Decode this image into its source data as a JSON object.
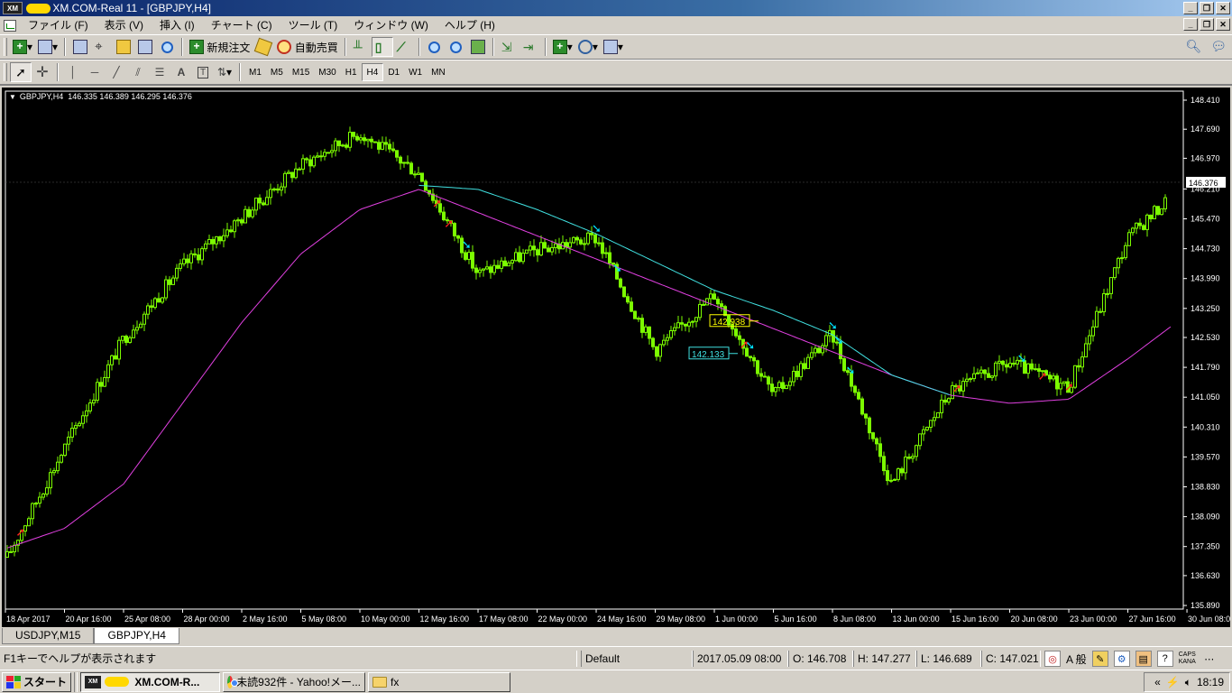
{
  "window": {
    "title": "XM.COM-Real 11 - [GBPJPY,H4]",
    "app_logo": "XM"
  },
  "menu": [
    "ファイル (F)",
    "表示 (V)",
    "挿入 (I)",
    "チャート (C)",
    "ツール (T)",
    "ウィンドウ (W)",
    "ヘルプ (H)"
  ],
  "toolbar1": {
    "new_order_label": "新規注文",
    "auto_trade_label": "自動売買"
  },
  "timeframes": [
    "M1",
    "M5",
    "M15",
    "M30",
    "H1",
    "H4",
    "D1",
    "W1",
    "MN"
  ],
  "active_timeframe": "H4",
  "chart": {
    "symbol_label": "GBPJPY,H4",
    "ohlc_label": "146.335 146.389 146.295 146.376",
    "current_price": "146.376",
    "annotation_upper": "142.938",
    "annotation_lower": "142.133",
    "background": "#000000",
    "candle_color": "#7cfc00",
    "ma_fast_color": "#40e0e0",
    "ma_slow_color": "#e040e0",
    "signal_up_color": "#ff2020",
    "signal_down_color": "#00e0ff"
  },
  "chart_data": {
    "type": "line",
    "title": "GBPJPY,H4",
    "x_tick_labels": [
      "18 Apr 2017",
      "20 Apr 16:00",
      "25 Apr 08:00",
      "28 Apr 00:00",
      "2 May 16:00",
      "5 May 08:00",
      "10 May 00:00",
      "12 May 16:00",
      "17 May 08:00",
      "22 May 00:00",
      "24 May 16:00",
      "29 May 08:00",
      "1 Jun 00:00",
      "5 Jun 16:00",
      "8 Jun 08:00",
      "13 Jun 00:00",
      "15 Jun 16:00",
      "20 Jun 08:00",
      "23 Jun 00:00",
      "27 Jun 16:00",
      "30 Jun 08:00"
    ],
    "y_tick_labels": [
      "148.410",
      "147.690",
      "146.970",
      "146.210",
      "145.470",
      "144.730",
      "143.990",
      "143.250",
      "142.530",
      "141.790",
      "141.050",
      "140.310",
      "139.570",
      "138.830",
      "138.090",
      "137.350",
      "136.630",
      "135.890"
    ],
    "ylim": [
      135.89,
      148.41
    ],
    "series": [
      {
        "name": "GBPJPY,H4",
        "x": [
          "18 Apr 2017",
          "20 Apr 16:00",
          "25 Apr 08:00",
          "28 Apr 00:00",
          "2 May 16:00",
          "5 May 08:00",
          "10 May 00:00",
          "12 May 16:00",
          "17 May 08:00",
          "22 May 00:00",
          "24 May 16:00",
          "29 May 08:00",
          "1 Jun 00:00",
          "5 Jun 16:00",
          "8 Jun 08:00",
          "13 Jun 00:00",
          "15 Jun 16:00",
          "20 Jun 08:00",
          "23 Jun 00:00",
          "27 Jun 16:00",
          "30 Jun 08:00"
        ],
        "values": [
          137.0,
          139.8,
          142.5,
          144.3,
          145.5,
          146.8,
          147.6,
          146.6,
          144.1,
          144.7,
          145.0,
          142.2,
          143.6,
          141.1,
          142.6,
          138.9,
          141.2,
          141.9,
          141.3,
          145.0,
          146.4
        ]
      },
      {
        "name": "MA slow",
        "x": [
          "18 Apr 2017",
          "20 Apr 16:00",
          "25 Apr 08:00",
          "28 Apr 00:00",
          "2 May 16:00",
          "5 May 08:00",
          "10 May 00:00",
          "12 May 16:00",
          "13 Jun 00:00",
          "15 Jun 16:00",
          "20 Jun 08:00",
          "23 Jun 00:00",
          "27 Jun 16:00",
          "30 Jun 08:00"
        ],
        "values": [
          137.3,
          137.8,
          138.9,
          140.9,
          142.9,
          144.6,
          145.7,
          146.2,
          141.6,
          141.1,
          140.9,
          141.0,
          142.0,
          143.1
        ]
      },
      {
        "name": "MA fast",
        "x": [
          "12 May 16:00",
          "17 May 08:00",
          "22 May 00:00",
          "24 May 16:00",
          "29 May 08:00",
          "1 Jun 00:00",
          "5 Jun 16:00",
          "8 Jun 08:00",
          "13 Jun 00:00",
          "15 Jun 16:00"
        ],
        "values": [
          146.3,
          146.2,
          145.7,
          145.1,
          144.4,
          143.7,
          143.2,
          142.6,
          141.6,
          141.1
        ]
      }
    ]
  },
  "chart_tabs": [
    "USDJPY,M15",
    "GBPJPY,H4"
  ],
  "active_chart_tab": "GBPJPY,H4",
  "status": {
    "help": "F1キーでヘルプが表示されます",
    "profile": "Default",
    "datetime": "2017.05.09 08:00",
    "open": "O: 146.708",
    "high": "H: 147.277",
    "low": "L: 146.689",
    "close": "C: 147.021",
    "ime_mode": "A 般",
    "caps": "CAPS",
    "kana": "KANA"
  },
  "taskbar": {
    "start_label": "スタート",
    "buttons": [
      {
        "label": "XM.COM-R...",
        "icon": "xm-icon"
      },
      {
        "label": "未読932件 - Yahoo!メー...",
        "icon": "chrome-icon"
      },
      {
        "label": "fx",
        "icon": "folder-icon"
      }
    ],
    "clock": "18:19"
  }
}
